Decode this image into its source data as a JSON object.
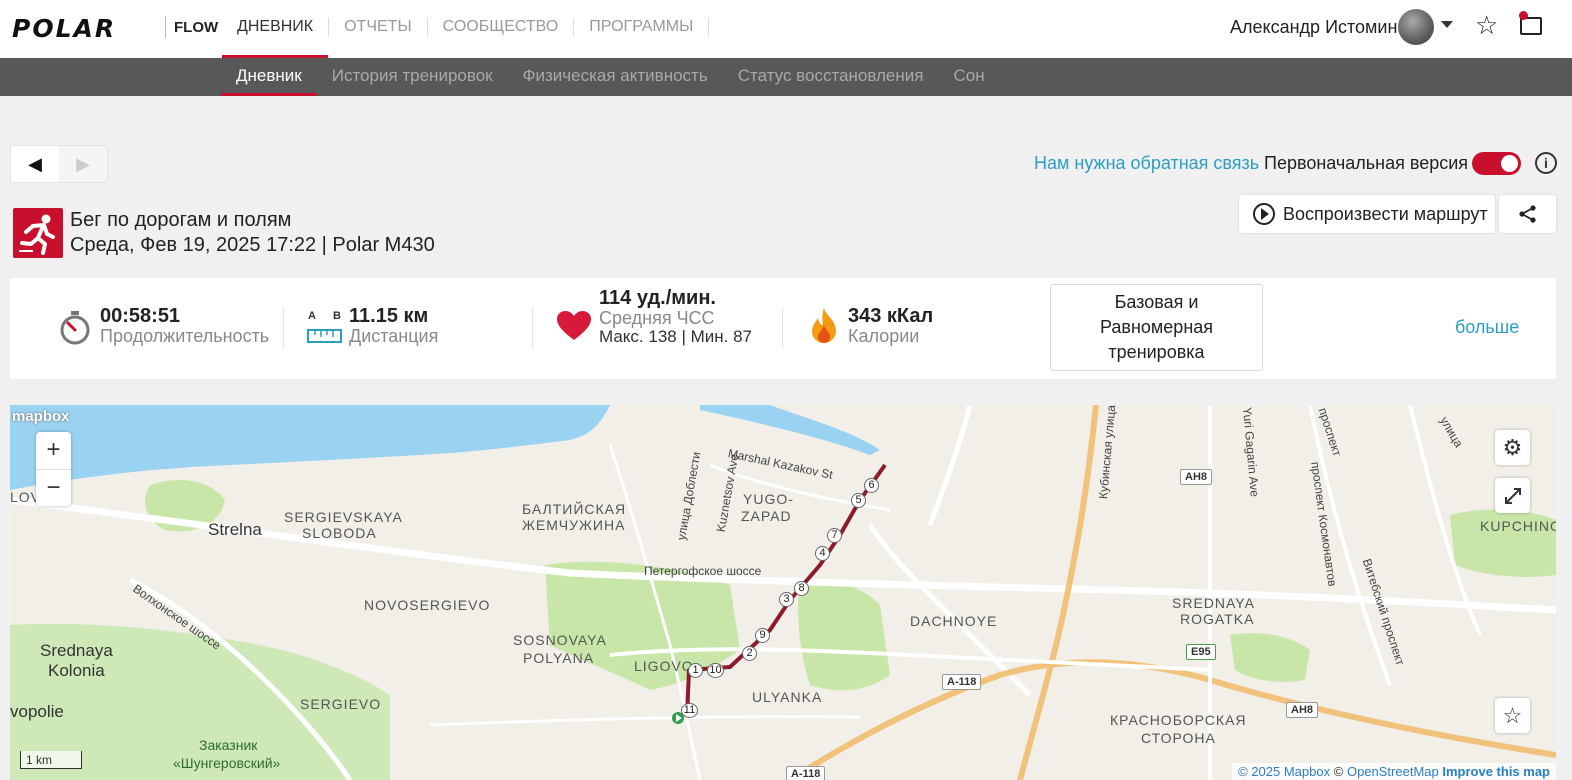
{
  "app": {
    "logo": "POLAR",
    "flow": "FLOW"
  },
  "top_nav": {
    "items": [
      "ДНЕВНИК",
      "ОТЧЕТЫ",
      "СООБЩЕСТВО",
      "ПРОГРАММЫ"
    ],
    "active": "ДНЕВНИК"
  },
  "user": {
    "name": "Александр Истомин"
  },
  "sub_nav": {
    "items": [
      "Дневник",
      "История тренировок",
      "Физическая активность",
      "Статус восстановления",
      "Сон"
    ],
    "active": "Дневник"
  },
  "toolbar": {
    "feedback_link": "Нам нужна обратная связь",
    "original_version_label": "Первоначальная версия",
    "original_version_on": true,
    "info_icon": "i"
  },
  "session": {
    "sport": "Бег по дорогам и полям",
    "datetime_device": "Среда, Фев 19, 2025 17:22 | Polar M430",
    "play_route_label": "Воспроизвести маршрут"
  },
  "summary": {
    "duration": {
      "value": "00:58:51",
      "label": "Продолжительность"
    },
    "distance": {
      "value": "11.15 км",
      "label": "Дистанция",
      "marker_a": "A",
      "marker_b": "B"
    },
    "heart_rate": {
      "value": "114 уд./мин.",
      "label": "Средняя ЧСС",
      "max_min": "Макс. 138  |  Мин. 87"
    },
    "calories": {
      "value": "343 кКал",
      "label": "Калории"
    },
    "training_benefit": {
      "line1": "Базовая и",
      "line2": "Равномерная",
      "line3": "тренировка"
    },
    "more_link": "больше"
  },
  "map": {
    "provider_logo": "mapbox",
    "zoom_in": "+",
    "zoom_out": "−",
    "scale": "1 km",
    "attribution": {
      "mapbox": "© 2025 Mapbox",
      "osm": "OpenStreetMap",
      "improve": "Improve this map",
      "copy": "©"
    },
    "labels": {
      "strelna": "Strelna",
      "sergievskaya": "SERGIEVSKAYA",
      "sloboda": "SLOBODA",
      "baltic1": "БАЛТИЙСКАЯ",
      "baltic2": "ЖЕМЧУЖИНА",
      "yugo": "YUGO-",
      "zapad": "ZAPAD",
      "novosergievo": "NOVOSERGIEVO",
      "sosnovaya": "SOSNOVAYA",
      "polyana": "POLYANA",
      "ligovo": "LIGOVO",
      "ulyanka": "ULYANKA",
      "sergievo": "SERGIEVO",
      "dachnoye": "DACHNOYE",
      "srednaya": "SREDNAYA",
      "rogatka": "ROGATKA",
      "kupchino": "KUPCHINO",
      "srednaya_kolonia1": "Srednaya",
      "srednaya_kolonia2": "Kolonia",
      "vopolie": "vopolie",
      "lov": "LOV",
      "zakaznik1": "Заказник",
      "zakaznik2": "«Шунгеровский»",
      "krasnoselskaya1": "КРАСНОБОРСКАЯ",
      "krasnoselskaya2": "СТОРОНА",
      "peterhof": "Петергофское шоссе",
      "volkonskoe": "Волхонское шоссе",
      "dobelsti": "улица Доблести",
      "kuznetsov": "Kuznetsov Ave",
      "marshal": "Marshal Kazakov St",
      "kubinskaya": "Кубинская улица",
      "gagarin": "Yuri Gagarin Ave",
      "kosmonavtov": "проспект Космонавтов",
      "vitebsky": "Витебский проспект",
      "prospekt": "проспект",
      "ulitsa": "улица"
    },
    "shields": [
      "AH8",
      "A-118",
      "E95",
      "AH8",
      "A-118"
    ],
    "km_markers": [
      "1",
      "2",
      "3",
      "4",
      "5",
      "6",
      "7",
      "8",
      "9",
      "10",
      "11"
    ]
  },
  "colors": {
    "brand_red": "#c8102e",
    "link_blue": "#2a9fc2",
    "subnav_bg": "#585858",
    "route": "#8b1a2b",
    "water": "#9ad2f2",
    "park": "#c7e6a8"
  }
}
